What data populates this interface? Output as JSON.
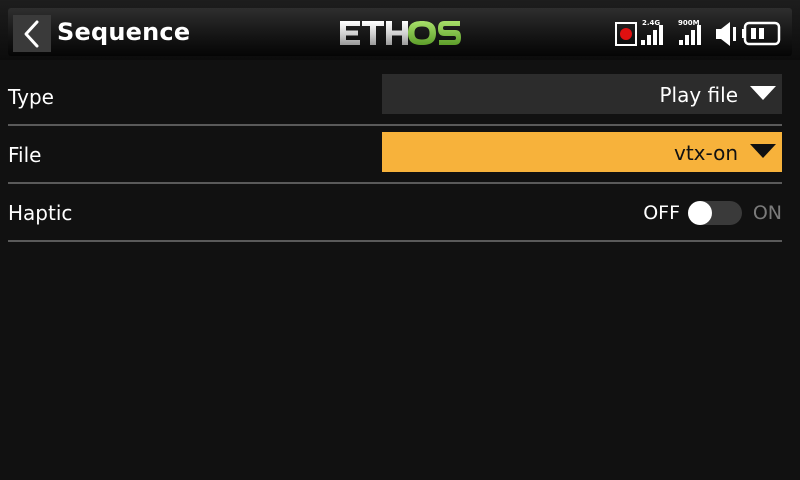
{
  "header": {
    "title": "Sequence",
    "logo_text": "ETHOS",
    "back_icon": "chevron-left-icon"
  },
  "status": {
    "band1_label": "2.4G",
    "band2_label": "900M",
    "icons": [
      "record-icon",
      "signal-2-4g-icon",
      "signal-900m-icon",
      "speaker-icon",
      "battery-icon"
    ]
  },
  "rows": {
    "type": {
      "label": "Type",
      "value": "Play file"
    },
    "file": {
      "label": "File",
      "value": "vtx-on"
    },
    "haptic": {
      "label": "Haptic",
      "off_label": "OFF",
      "on_label": "ON",
      "state": "off"
    }
  },
  "colors": {
    "accent": "#f7b23b",
    "logo_green": "#7ac143",
    "background": "#111111",
    "record": "#e01010"
  }
}
